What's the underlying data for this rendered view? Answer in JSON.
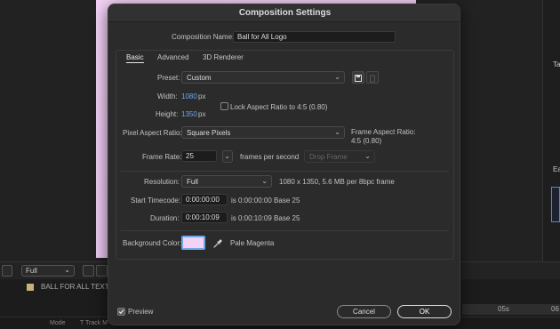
{
  "background": {
    "resolution_select": "Full",
    "layer_name": "BALL FOR ALL TEXT LO",
    "mode_label": "Mode",
    "track_label": "T   Track M",
    "ruler_05": "05s",
    "ruler_06": "06",
    "side_ta": "Ta",
    "side_ea": "Ea"
  },
  "dialog": {
    "title": "Composition Settings",
    "comp_name_label": "Composition Name:",
    "comp_name_value": "Ball for All Logo",
    "tabs": [
      {
        "label": "Basic",
        "active": true
      },
      {
        "label": "Advanced",
        "active": false
      },
      {
        "label": "3D Renderer",
        "active": false
      }
    ],
    "preset_label": "Preset:",
    "preset_value": "Custom",
    "width_label": "Width:",
    "width_value": "1080",
    "width_unit": "px",
    "height_label": "Height:",
    "height_value": "1350",
    "height_unit": "px",
    "lock_aspect_label": "Lock Aspect Ratio to 4:5 (0.80)",
    "lock_aspect_checked": false,
    "pixel_aspect_label": "Pixel Aspect Ratio:",
    "pixel_aspect_value": "Square Pixels",
    "frame_aspect_label": "Frame Aspect Ratio:",
    "frame_aspect_value": "4:5 (0.80)",
    "frame_rate_label": "Frame Rate:",
    "frame_rate_value": "25",
    "frames_per_second": "frames per second",
    "drop_frame": "Drop Frame",
    "resolution_label": "Resolution:",
    "resolution_value": "Full",
    "resolution_info": "1080 x 1350, 5.6 MB per 8bpc frame",
    "start_timecode_label": "Start Timecode:",
    "start_timecode_value": "0:00:00:00",
    "start_timecode_info": "is 0:00:00:00  Base 25",
    "duration_label": "Duration:",
    "duration_value": "0:00:10:09",
    "duration_info": "is 0:00:10:09  Base 25",
    "bg_color_label": "Background Color:",
    "bg_color_hex": "#f2d3f5",
    "bg_color_name": "Pale Magenta",
    "preview_label": "Preview",
    "preview_checked": true,
    "cancel_label": "Cancel",
    "ok_label": "OK"
  }
}
